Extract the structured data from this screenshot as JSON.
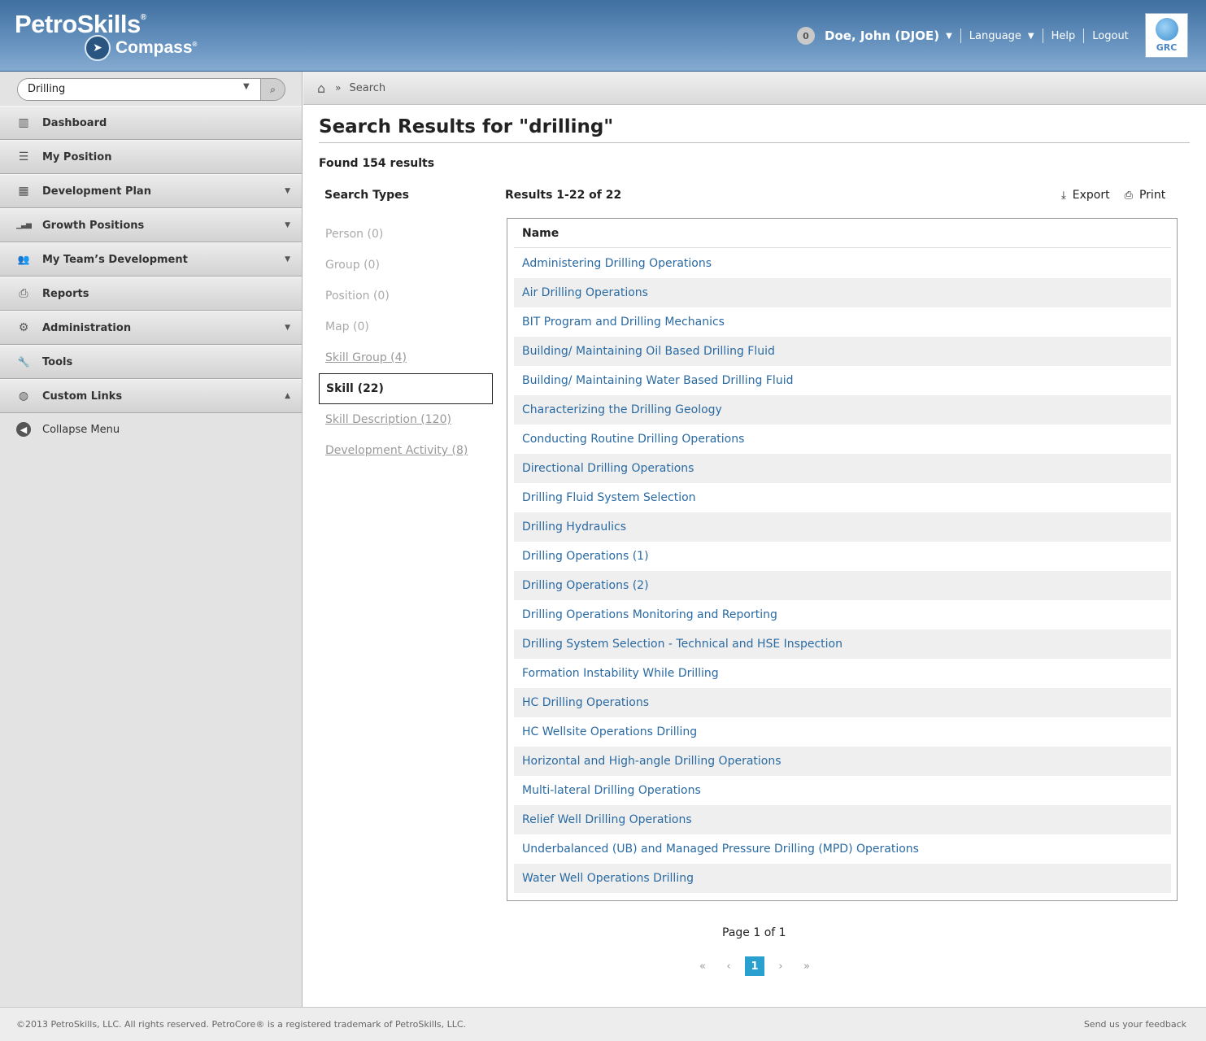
{
  "header": {
    "brand": "PetroSkills",
    "brand_mark": "®",
    "product": "Compass",
    "product_mark": "®",
    "notification_count": "0",
    "user_name": "Doe, John (DJOE)",
    "language_label": "Language",
    "help_label": "Help",
    "logout_label": "Logout",
    "grc_label": "GRC"
  },
  "sidebar": {
    "search_value": "Drilling",
    "items": [
      {
        "label": "Dashboard",
        "icon": "bar-chart-icon",
        "glyph": "▥",
        "expand": ""
      },
      {
        "label": "My Position",
        "icon": "list-icon",
        "glyph": "☰",
        "expand": ""
      },
      {
        "label": "Development Plan",
        "icon": "calendar-icon",
        "glyph": "▦",
        "expand": "▼"
      },
      {
        "label": "Growth Positions",
        "icon": "signal-icon",
        "glyph": "▁▃▅",
        "expand": "▼"
      },
      {
        "label": "My Team’s Development",
        "icon": "users-icon",
        "glyph": "👥",
        "expand": "▼"
      },
      {
        "label": "Reports",
        "icon": "printer-icon",
        "glyph": "⎙",
        "expand": ""
      },
      {
        "label": "Administration",
        "icon": "gears-icon",
        "glyph": "⚙",
        "expand": "▼"
      },
      {
        "label": "Tools",
        "icon": "wrench-icon",
        "glyph": "🔧",
        "expand": ""
      },
      {
        "label": "Custom Links",
        "icon": "globe-icon",
        "glyph": "◍",
        "expand": "▲"
      }
    ],
    "collapse_label": "Collapse Menu"
  },
  "breadcrumb": {
    "current": "Search"
  },
  "main": {
    "title": "Search Results for \"drilling\"",
    "found": "Found 154 results",
    "types_heading": "Search Types",
    "types": [
      {
        "label": "Person (0)",
        "state": "disabled"
      },
      {
        "label": "Group (0)",
        "state": "disabled"
      },
      {
        "label": "Position (0)",
        "state": "disabled"
      },
      {
        "label": "Map (0)",
        "state": "disabled"
      },
      {
        "label": "Skill Group (4)",
        "state": "link"
      },
      {
        "label": "Skill (22)",
        "state": "active"
      },
      {
        "label": "Skill Description (120)",
        "state": "link"
      },
      {
        "label": "Development Activity (8)",
        "state": "link"
      }
    ],
    "results_heading": "Results 1-22 of 22",
    "export_label": "Export",
    "print_label": "Print",
    "column_header": "Name",
    "results": [
      "Administering Drilling Operations",
      "Air Drilling Operations",
      "BIT Program and Drilling Mechanics",
      "Building/ Maintaining Oil Based Drilling Fluid",
      "Building/ Maintaining Water Based Drilling Fluid",
      "Characterizing the Drilling Geology",
      "Conducting Routine Drilling Operations",
      "Directional Drilling Operations",
      "Drilling Fluid System Selection",
      "Drilling Hydraulics",
      "Drilling Operations (1)",
      "Drilling Operations (2)",
      "Drilling Operations Monitoring and Reporting",
      "Drilling System Selection - Technical and HSE Inspection",
      "Formation Instability While Drilling",
      "HC Drilling Operations",
      "HC Wellsite Operations Drilling",
      "Horizontal and High-angle Drilling Operations",
      "Multi-lateral Drilling Operations",
      "Relief Well Drilling Operations",
      "Underbalanced (UB) and Managed Pressure Drilling (MPD) Operations",
      "Water Well Operations Drilling"
    ],
    "pager_text": "Page 1 of 1",
    "pager": {
      "first": "«",
      "prev": "‹",
      "current": "1",
      "next": "›",
      "last": "»"
    }
  },
  "footer": {
    "copyright": "©2013 PetroSkills, LLC. All rights reserved. PetroCore® is a registered trademark of PetroSkills, LLC.",
    "feedback": "Send us your feedback"
  },
  "colors": {
    "header_top": "#3f6f9f",
    "link": "#2a6aa3",
    "pager_active": "#2aa0cf"
  }
}
